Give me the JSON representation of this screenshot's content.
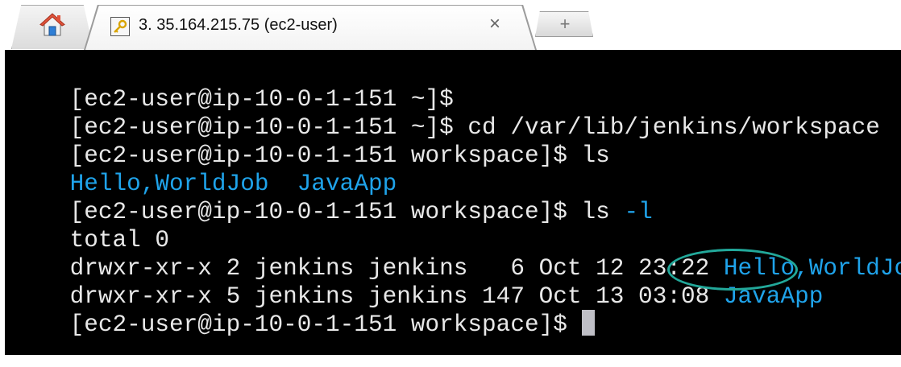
{
  "tabs": {
    "home_icon": "home-icon",
    "active": {
      "icon": "key-icon",
      "title": "3. 35.164.215.75 (ec2-user)",
      "close": "×"
    },
    "new_tab_symbol": "+"
  },
  "terminal": {
    "background": "#000000",
    "text_color": "#e8e8e8",
    "dir_color": "#1fa3ea",
    "highlight_color": "#22a89a",
    "lines": {
      "l1_prompt": "[ec2-user@ip-10-0-1-151 ~]$",
      "l2_prompt": "[ec2-user@ip-10-0-1-151 ~]$ ",
      "l2_cmd": "cd /var/lib/jenkins/workspace",
      "l3_prompt": "[ec2-user@ip-10-0-1-151 workspace]$ ",
      "l3_cmd": "ls",
      "l4_dir1": "Hello,WorldJob",
      "l4_sep": "  ",
      "l4_dir2": "JavaApp",
      "l5_prompt": "[ec2-user@ip-10-0-1-151 workspace]$ ",
      "l5_cmd": "ls ",
      "l5_flag": "-l",
      "l6_total": "total 0",
      "l7_meta": "drwxr-xr-x 2 jenkins jenkins   6 Oct 12 23:22 ",
      "l7_dir": "Hello,WorldJob",
      "l8_meta": "drwxr-xr-x 5 jenkins jenkins 147 Oct 13 03:08 ",
      "l8_dir": "JavaApp",
      "l9_prompt": "[ec2-user@ip-10-0-1-151 workspace]$ "
    }
  }
}
